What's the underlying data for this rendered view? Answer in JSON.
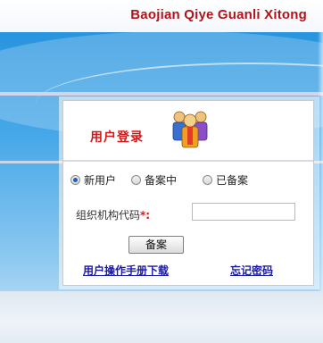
{
  "header": {
    "brand_title": "Baojian Qiye Guanli Xitong"
  },
  "login": {
    "title": "用户登录",
    "icon": "users-group-icon",
    "radio_options": [
      {
        "label": "新用户",
        "checked": true
      },
      {
        "label": "备案中",
        "checked": false
      },
      {
        "label": "已备案",
        "checked": false
      }
    ],
    "code_field": {
      "label": "组织机构代码",
      "required_mark": "*:",
      "value": "",
      "placeholder": ""
    },
    "submit_label": "备案",
    "manual_link": "用户操作手册下载",
    "forgot_link": "忘记密码"
  },
  "colors": {
    "brand_red": "#b3121b",
    "title_red": "#d21a1a",
    "link_blue": "#1a1aa8",
    "bg_blue": "#1f8fdb"
  }
}
